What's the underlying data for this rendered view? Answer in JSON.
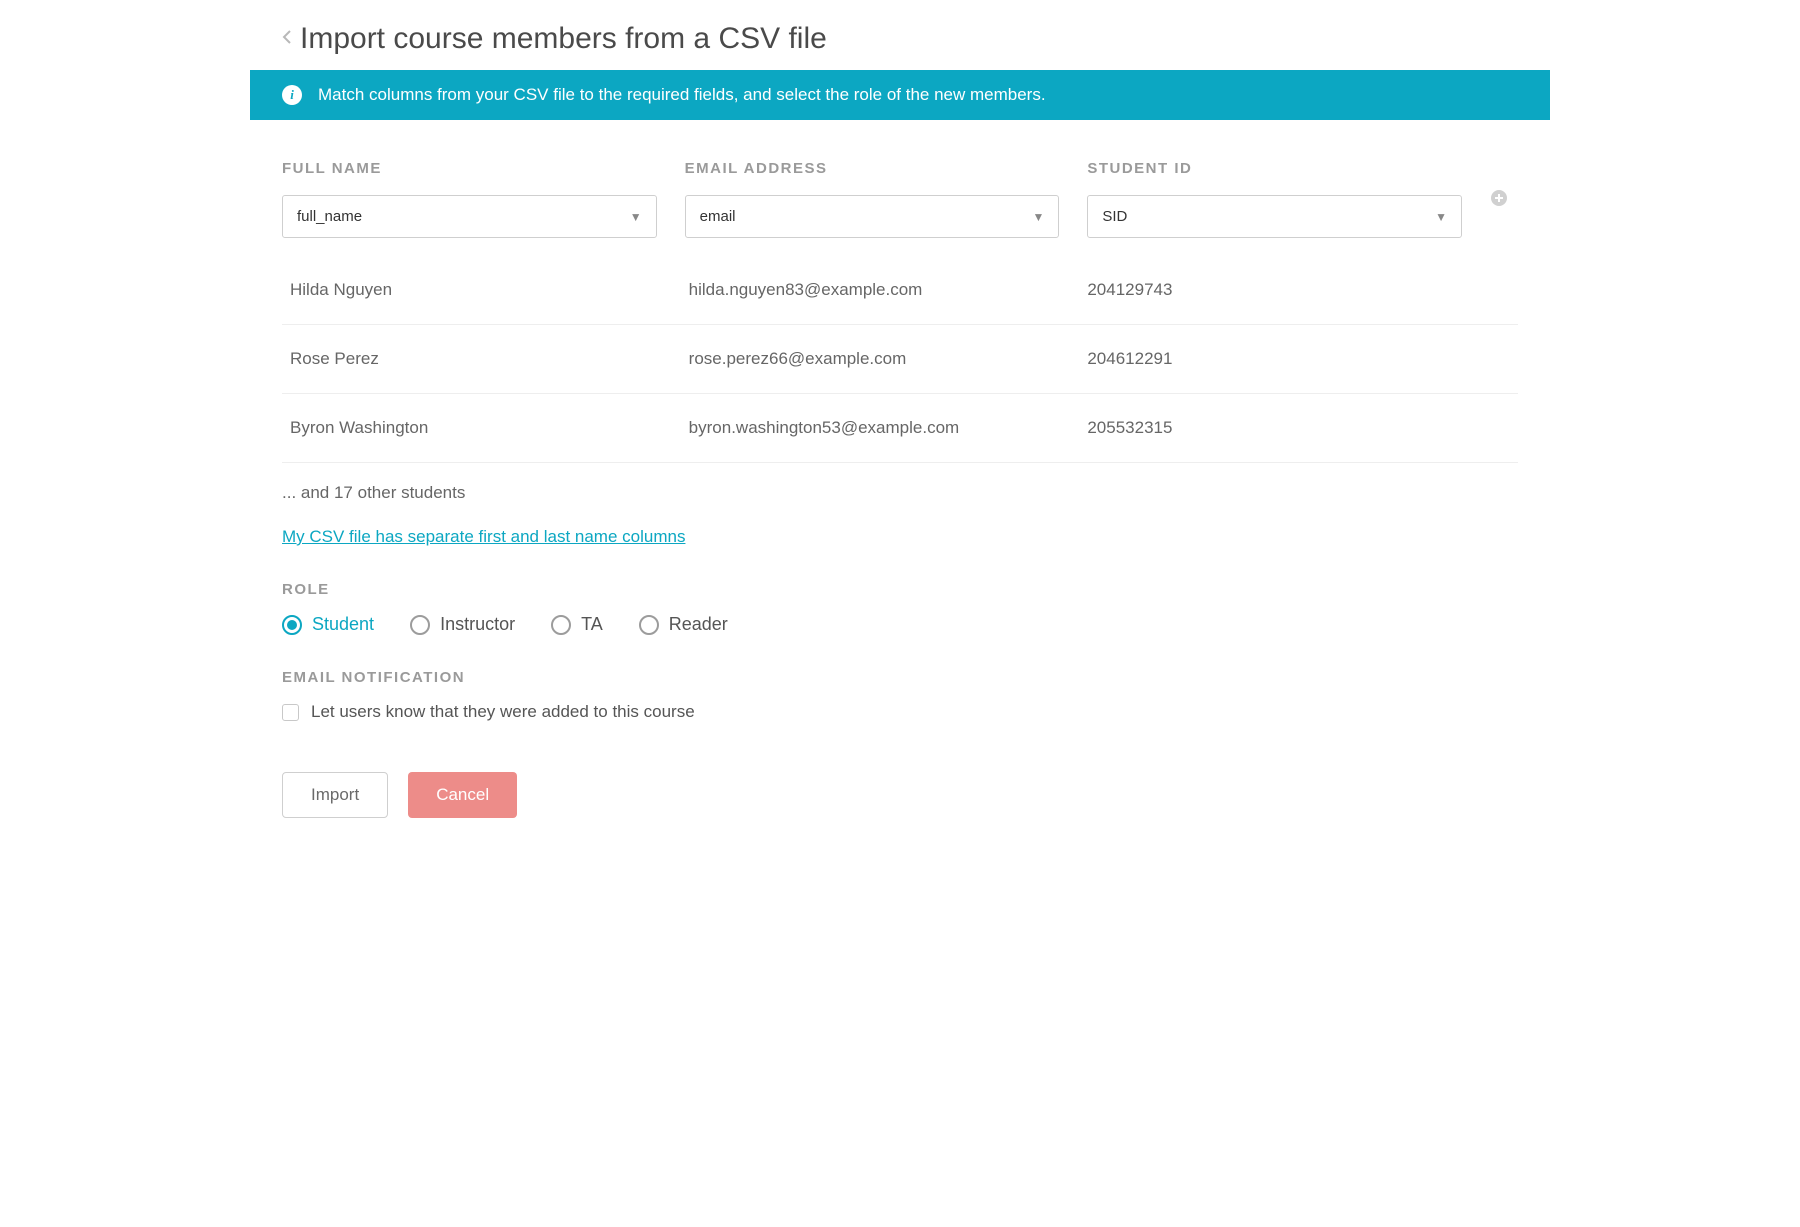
{
  "header": {
    "title": "Import course members from a CSV file"
  },
  "banner": {
    "text": "Match columns from your CSV file to the required fields, and select the role of the new members."
  },
  "columns": [
    {
      "label": "FULL NAME",
      "value": "full_name"
    },
    {
      "label": "EMAIL ADDRESS",
      "value": "email"
    },
    {
      "label": "STUDENT ID",
      "value": "SID"
    }
  ],
  "preview_rows": [
    {
      "name": "Hilda Nguyen",
      "email": "hilda.nguyen83@example.com",
      "sid": "204129743"
    },
    {
      "name": "Rose Perez",
      "email": "rose.perez66@example.com",
      "sid": "204612291"
    },
    {
      "name": "Byron Washington",
      "email": "byron.washington53@example.com",
      "sid": "205532315"
    }
  ],
  "more_text": "... and 17 other students",
  "separate_name_link": "My CSV file has separate first and last name columns",
  "role": {
    "label": "ROLE",
    "options": [
      {
        "label": "Student",
        "selected": true
      },
      {
        "label": "Instructor",
        "selected": false
      },
      {
        "label": "TA",
        "selected": false
      },
      {
        "label": "Reader",
        "selected": false
      }
    ]
  },
  "email_notification": {
    "label": "EMAIL NOTIFICATION",
    "checkbox_label": "Let users know that they were added to this course",
    "checked": false
  },
  "buttons": {
    "import": "Import",
    "cancel": "Cancel"
  }
}
